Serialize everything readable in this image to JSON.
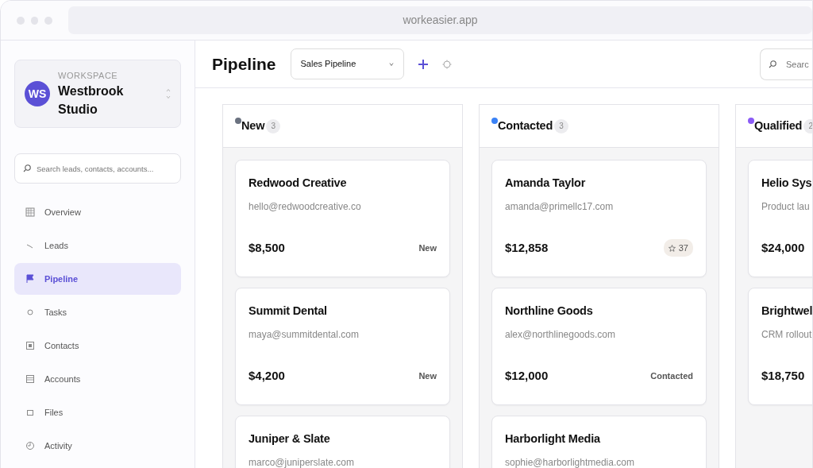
{
  "browser": {
    "address": "workeasier.app"
  },
  "workspace": {
    "label": "WORKSPACE",
    "initials": "WS",
    "name": "Westbrook Studio"
  },
  "sidebar": {
    "search": {
      "placeholder": "Search leads, contacts, accounts..."
    },
    "items": [
      {
        "label": "Overview",
        "selected": false
      },
      {
        "label": "Leads",
        "selected": false
      },
      {
        "label": "Pipeline",
        "selected": true
      },
      {
        "label": "Tasks",
        "selected": false
      },
      {
        "label": "Contacts",
        "selected": false
      },
      {
        "label": "Accounts",
        "selected": false
      },
      {
        "label": "Files",
        "selected": false
      },
      {
        "label": "Activity",
        "selected": false
      }
    ]
  },
  "header": {
    "title": "Pipeline",
    "pipeline_select": "Sales Pipeline",
    "search": {
      "placeholder": "Searc"
    }
  },
  "columns": [
    {
      "title": "New",
      "count": "3",
      "color": "#6b7280",
      "cards": [
        {
          "name": "Redwood Creative",
          "detail": "hello@redwoodcreative.co",
          "amount": "$8,500",
          "badge": {
            "kind": "status",
            "text": "New"
          }
        },
        {
          "name": "Summit Dental",
          "detail": "maya@summitdental.com",
          "amount": "$4,200",
          "badge": {
            "kind": "status",
            "text": "New"
          }
        },
        {
          "name": "Juniper & Slate",
          "detail": "marco@juniperslate.com"
        }
      ]
    },
    {
      "title": "Contacted",
      "count": "3",
      "color": "#3b82f6",
      "cards": [
        {
          "name": "Amanda Taylor",
          "detail": "amanda@primellc17.com",
          "amount": "$12,858",
          "badge": {
            "kind": "score",
            "text": "37"
          }
        },
        {
          "name": "Northline Goods",
          "detail": "alex@northlinegoods.com",
          "amount": "$12,000",
          "badge": {
            "kind": "status",
            "text": "Contacted"
          }
        },
        {
          "name": "Harborlight Media",
          "detail": "sophie@harborlightmedia.com"
        }
      ]
    },
    {
      "title": "Qualified",
      "count": "2",
      "color": "#8b5cf6",
      "cards": [
        {
          "name": "Helio Sys",
          "detail": "Product lau",
          "amount": "$24,000"
        },
        {
          "name": "Brightwel",
          "detail": "CRM rollout",
          "amount": "$18,750"
        }
      ]
    }
  ]
}
